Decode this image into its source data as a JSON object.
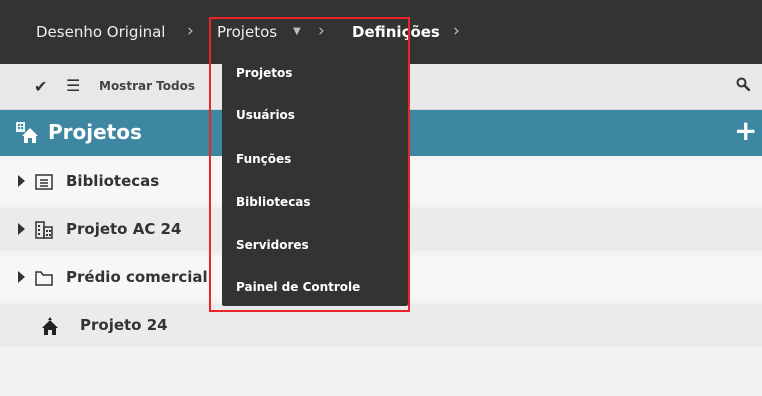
{
  "breadcrumb": {
    "items": [
      "Desenho Original",
      "Projetos",
      "Definições"
    ]
  },
  "toolbar": {
    "filter_label": "Mostrar Todos"
  },
  "section": {
    "title": "Projetos",
    "color": "#3d87a2"
  },
  "tree": {
    "items": [
      {
        "label": "Bibliotecas",
        "icon": "library-icon",
        "expandable": true
      },
      {
        "label": "Projeto AC 24",
        "icon": "building-icon",
        "expandable": true
      },
      {
        "label": "Prédio comercial",
        "icon": "folder-icon",
        "expandable": true
      },
      {
        "label": "Projeto 24",
        "icon": "project-house-icon",
        "expandable": false
      }
    ]
  },
  "dropdown": {
    "items": [
      "Projetos",
      "Usuários",
      "Funções",
      "Bibliotecas",
      "Servidores",
      "Painel de Controle"
    ]
  },
  "highlight_color": "#e8262b"
}
